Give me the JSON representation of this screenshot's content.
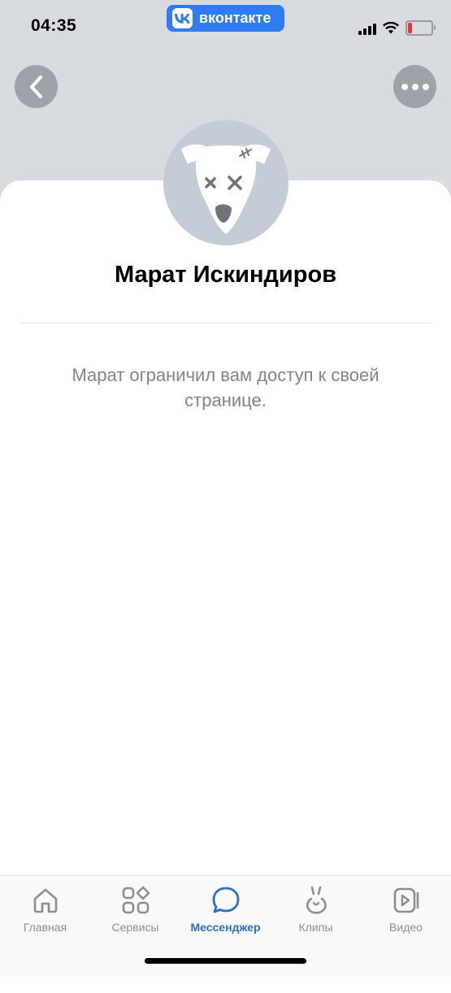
{
  "status_bar": {
    "time": "04:35",
    "app_badge": "вконтакте",
    "battery_color": "#e33333"
  },
  "header": {
    "back_icon": "chevron-left-icon",
    "more_icon": "ellipsis-icon"
  },
  "profile": {
    "name": "Марат Искиндиров",
    "avatar_icon": "deactivated-dog-icon",
    "message": "Марат ограничил вам доступ к своей странице."
  },
  "tab_bar": {
    "items": [
      {
        "label": "Главная",
        "icon": "home-icon",
        "active": false
      },
      {
        "label": "Сервисы",
        "icon": "services-icon",
        "active": false
      },
      {
        "label": "Мессенджер",
        "icon": "messenger-icon",
        "active": true
      },
      {
        "label": "Клипы",
        "icon": "clips-icon",
        "active": false
      },
      {
        "label": "Видео",
        "icon": "video-icon",
        "active": false
      }
    ]
  },
  "colors": {
    "header_bg": "#d8dbe0",
    "accent": "#2d6ec7",
    "vk_blue": "#2f7cf2",
    "inactive": "#8c8e93"
  }
}
